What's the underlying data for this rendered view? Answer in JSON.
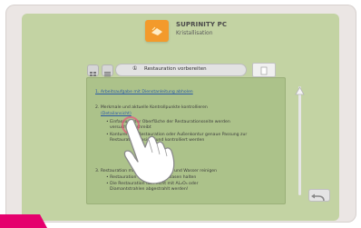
{
  "header": {
    "title": "SUPRINITY PC",
    "subtitle": "Kristallisation"
  },
  "toolbar": {
    "tab_number": "①",
    "tab_label": "Restauration vorbereiten"
  },
  "steps": {
    "s1": "1. Arbeitsaufgabe mit Dienstanleitung abholen",
    "s2": "2. Merkmale und aktuelle Kontrollpunkte kontrollieren",
    "s2_link": "(Detailansicht)",
    "s2_b1": "• Einfassung der Oberfläche der Restaurationsseite werden",
    "s2_b1b": "versucht beschreibt",
    "s2_b2": "• Konturen der Restauration oder Außenkontur genaue Passung zur",
    "s2_b2b": "Restaurationsbasis (Mund kontrolliert werden",
    "s3": "3. Restauration mit Reinigungsbürste und Wasser reinigen",
    "s3_b1": "• Restauration trocknen bzw. blasen halten",
    "s3_b2": "• Die Restauration darf nicht mit AL₂O₃ oder",
    "s3_b2b": "Diamantstrahlen abgestrahlt werden!"
  },
  "colors": {
    "screen_bg": "#c3d3a3",
    "content_bg": "#acc28a",
    "app_icon": "#f39a2b",
    "link": "#2a5aa5",
    "accent_corner": "#e5006d"
  }
}
